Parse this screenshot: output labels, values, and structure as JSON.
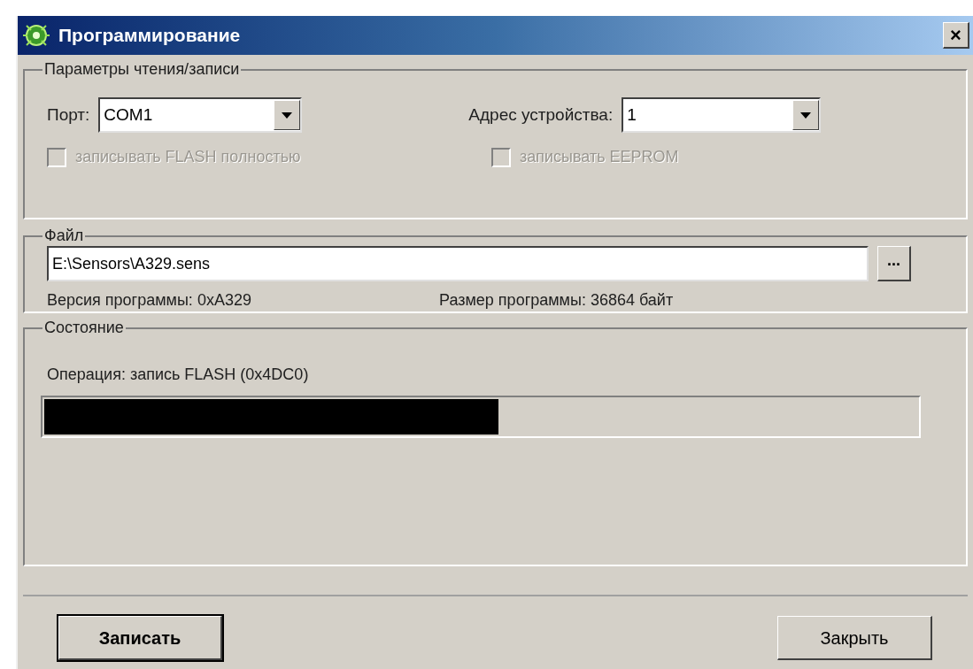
{
  "window": {
    "title": "Программирование",
    "close": "×"
  },
  "params": {
    "legend": "Параметры чтения/записи",
    "port_label": "Порт:",
    "port_value": "COM1",
    "address_label": "Адрес устройства:",
    "address_value": "1",
    "checkboxes": [
      {
        "label": "записывать FLASH полностью",
        "checked": false,
        "disabled": true
      },
      {
        "label": "записывать EEPROM",
        "checked": false,
        "disabled": true
      }
    ]
  },
  "file": {
    "legend": "Файл",
    "path": "E:\\Sensors\\A329.sens",
    "browse": "...",
    "version": "Версия программы: 0xA329",
    "size": "Размер программы: 36864 байт"
  },
  "status": {
    "legend": "Состояние",
    "operation": "Операция: запись FLASH (0x4DC0)",
    "level": 0.52
  },
  "buttons": [
    {
      "label": "Записать",
      "default": true
    },
    {
      "label": "Закрыть",
      "default": false
    }
  ]
}
